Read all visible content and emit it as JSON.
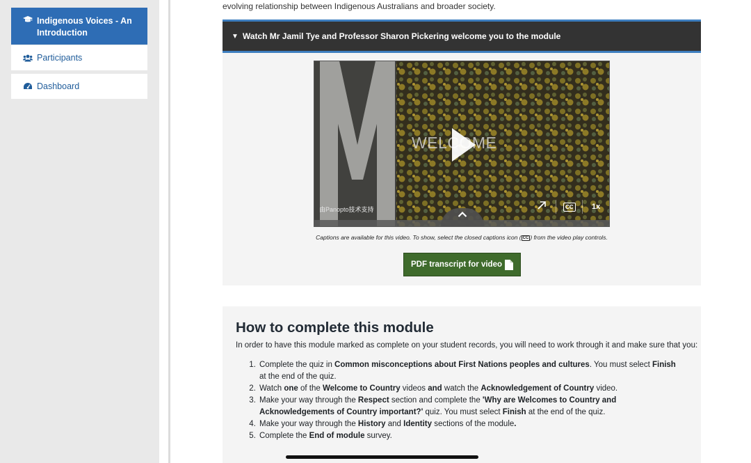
{
  "sidebar": {
    "active_item": {
      "label": "Indigenous Voices - An Introduction",
      "icon": "graduation-cap-icon"
    },
    "items": [
      {
        "label": "Participants",
        "icon": "users-icon"
      },
      {
        "label": "Dashboard",
        "icon": "dashboard-icon"
      }
    ]
  },
  "main": {
    "intro_text": "evolving relationship between Indigenous Australians and broader society.",
    "video_section": {
      "header": "Watch Mr Jamil Tye and Professor Sharon Pickering welcome you to the module",
      "player": {
        "overlay_text": "WELCOME",
        "watermark": "由Panopto技术支持",
        "speed": "1x",
        "cc_label": "CC"
      },
      "caption_note_before": "Captions are available for this video. To show, select the closed captions icon (",
      "caption_note_icon": "CC",
      "caption_note_after": ") from the video play controls.",
      "pdf_button": "PDF transcript for video"
    },
    "complete_section": {
      "title": "How to complete this module",
      "intro": "In order to have this module marked as complete on your student records, you will need to work through it and make sure that you:",
      "steps": [
        {
          "a": "Complete the quiz in ",
          "b": "Common misconceptions about First Nations peoples and cultures",
          "c": ". You must select ",
          "d": "Finish",
          "e": " at the end of the quiz."
        },
        {
          "a": "Watch ",
          "b": "one",
          "c": " of the ",
          "d": "Welcome to Country",
          "e": " videos ",
          "f": "and",
          "g": " watch the ",
          "h": "Acknowledgement of Country",
          "i": " video."
        },
        {
          "a": "Make your way through the ",
          "b": "Respect",
          "c": " section and complete the ",
          "d": "'Why are Welcomes to Country and Acknowledgements of Country important?'",
          "e": " quiz. You must select ",
          "f": "Finish",
          "g": " at the end of the quiz."
        },
        {
          "a": "Make your way through the ",
          "b": "History",
          "c": " and ",
          "d": "Identity",
          "e": " sections of the module",
          "f": "."
        },
        {
          "a": "Complete the ",
          "b": "End of module",
          "c": " survey."
        }
      ]
    }
  },
  "colors": {
    "active_nav": "#2e6db5",
    "nav_link": "#1f5c9a",
    "video_header_bg": "#333333",
    "video_header_accent": "#3d7ebf",
    "pdf_button": "#3f6b2c",
    "panel_bg": "#f4f4f4"
  }
}
